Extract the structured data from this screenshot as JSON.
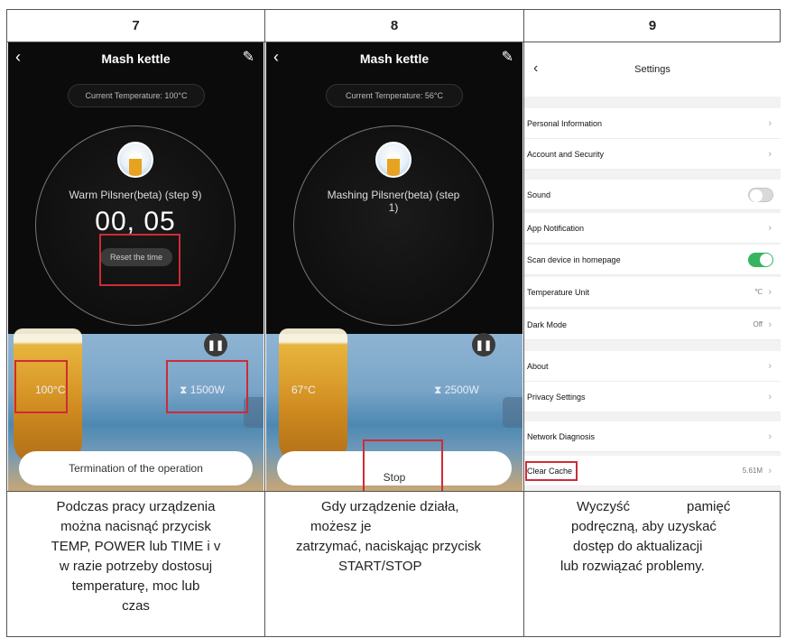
{
  "columns": [
    {
      "number": "7"
    },
    {
      "number": "8"
    },
    {
      "number": "9"
    }
  ],
  "screen7": {
    "title": "Mash kettle",
    "current_temp": "Current Temperature: 100°C",
    "step": "Warm Pilsner(beta) (step 9)",
    "timer": "00, 05",
    "reset_label": "Reset the time",
    "pause_icon": "pause-icon",
    "temp_value": "100°C",
    "power_value": "1500W",
    "bottom_button": "Termination of the operation"
  },
  "screen8": {
    "title": "Mash kettle",
    "current_temp": "Current Temperature: 56°C",
    "step_line1": "Mashing Pilsner(beta) (step",
    "step_line2": "1)",
    "pause_icon": "pause-icon",
    "temp_value": "67°C",
    "power_value": "2500W",
    "bottom_button": "Stop"
  },
  "screen9": {
    "title": "Settings",
    "items": {
      "personal": "Personal Information",
      "account": "Account and Security",
      "sound": "Sound",
      "notification": "App Notification",
      "scan": "Scan device in homepage",
      "temp_unit": "Temperature Unit",
      "temp_unit_value": "℃",
      "dark_mode": "Dark Mode",
      "dark_mode_value": "Off",
      "about": "About",
      "privacy": "Privacy Settings",
      "network": "Network Diagnosis",
      "clear_cache": "Clear Cache",
      "cache_value": "5.61M"
    },
    "toggles": {
      "sound": "off",
      "scan": "on",
      "on_color": "#37b45f",
      "off_color": "#d9d9d9"
    }
  },
  "captions": {
    "c7": [
      "Podczas pracy urządzenia",
      "można nacisnąć przycisk",
      "TEMP, POWER lub TIME i v",
      "w razie potrzeby dostosuj",
      "temperaturę, moc lub",
      "czas"
    ],
    "c8": [
      "Gdy urządzenie działa,",
      "możesz je",
      "zatrzymać, naciskając przycisk",
      "START/STOP"
    ],
    "c9_line1_a": "Wyczyść",
    "c9_line1_b": "pamięć",
    "c9": [
      "podręczną, aby uzyskać",
      "dostęp do aktualizacji",
      "lub rozwiązać problemy."
    ]
  },
  "colors": {
    "highlight": "#cf2b36",
    "border": "#555555"
  }
}
